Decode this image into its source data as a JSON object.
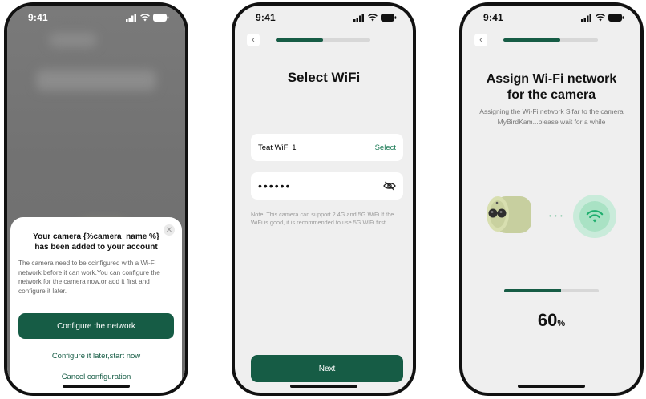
{
  "status_bar": {
    "time": "9:41"
  },
  "screen1": {
    "sheet": {
      "title": "Your camera {%camera_name %} has been added to your account",
      "description": "The camera need to be ccinfigured with a Wi-Fi network before it can work.You can configure the network for the camera now,or add it first and configure it later.",
      "primary_button": "Configure the network",
      "secondary_link": "Configure it later,start now",
      "cancel_link": "Cancel configuration",
      "close_icon": "close-icon"
    }
  },
  "screen2": {
    "title": "Select WiFi",
    "progress": 0.5,
    "wifi": {
      "name": "Teat WiFi 1",
      "action": "Select"
    },
    "password": {
      "masked": "••••••",
      "toggle_icon": "eye-off-icon"
    },
    "note": "Note: This camera can support 2.4G and 5G WiFi.If the WiFi is good, it is recommended to use 5G WiFi first.",
    "next_button": "Next"
  },
  "screen3": {
    "title_line1": "Assign Wi-Fi network",
    "title_line2": "for the camera",
    "subtitle": "Assigning the Wi-Fi network Sifar to the camera MyBirdKam...please wait for a while",
    "progress_top": 0.6,
    "progress": 0.6,
    "percent_value": "60",
    "percent_unit": "%"
  },
  "colors": {
    "brand": "#165c45",
    "accent_light": "#c9ebda",
    "background": "#efefef"
  }
}
